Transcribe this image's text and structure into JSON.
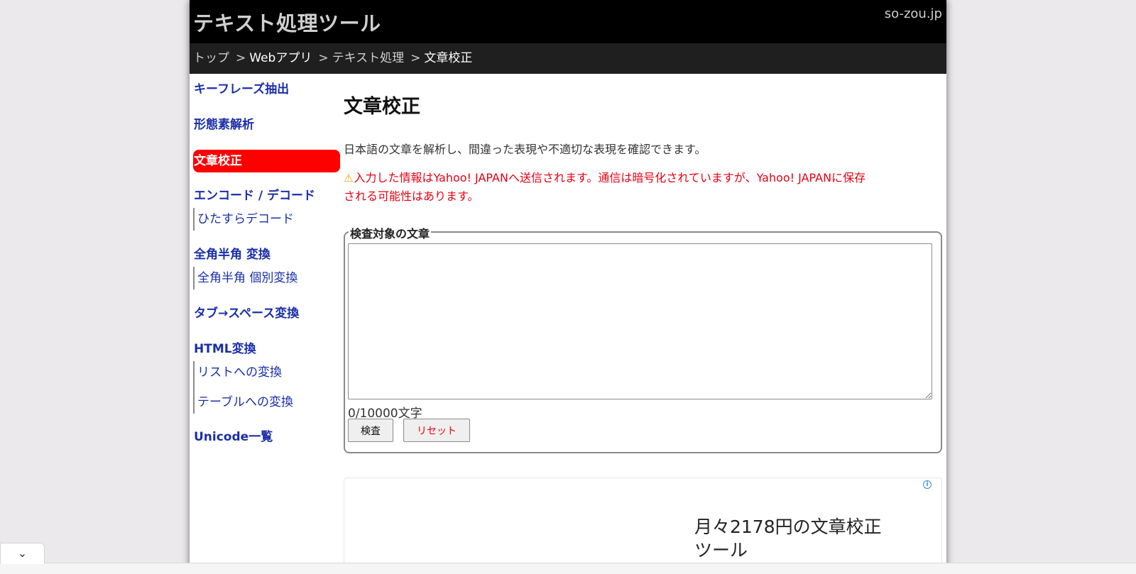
{
  "header": {
    "site_title": "テキスト処理ツール",
    "domain": "so-zou.jp"
  },
  "breadcrumb": {
    "items": [
      "トップ",
      "Webアプリ",
      "テキスト処理"
    ],
    "separator": ">",
    "current": "文章校正"
  },
  "sidebar": {
    "items": [
      {
        "label": "キーフレーズ抽出"
      },
      {
        "label": "形態素解析"
      },
      {
        "label": "文章校正"
      },
      {
        "label": "エンコード / デコード",
        "children": [
          "ひたすらデコード"
        ]
      },
      {
        "label": "全角半角 変換",
        "children": [
          "全角半角 個別変換"
        ]
      },
      {
        "label": "タブ→スペース変換"
      },
      {
        "label": "HTML変換",
        "children": [
          "リストへの変換",
          "テーブルへの変換"
        ]
      },
      {
        "label": "Unicode一覧"
      }
    ]
  },
  "main": {
    "title": "文章校正",
    "description": "日本語の文章を解析し、間違った表現や不適切な表現を確認できます。",
    "warning_line1": "入力した情報はYahoo! JAPANへ送信されます。通信は暗号化されていますが、Yahoo! JAPANに保存",
    "warning_line2": "される可能性はあります。",
    "form": {
      "legend": "検査対象の文章",
      "textarea_value": "",
      "char_count": "0/10000文字",
      "check_button": "検査",
      "reset_button": "リセット"
    }
  },
  "ad": {
    "info_icon": "i",
    "line1": "月々2178円の文章校正",
    "line2": "ツール"
  },
  "bottom": {
    "collapse_icon": "⌄"
  },
  "colors": {
    "header_bg": "#000000",
    "breadcrumb_bg": "#1f1f1f",
    "nav_link": "#1a2fa8",
    "active_bg": "#ff0000",
    "warning_red": "#e60012"
  }
}
